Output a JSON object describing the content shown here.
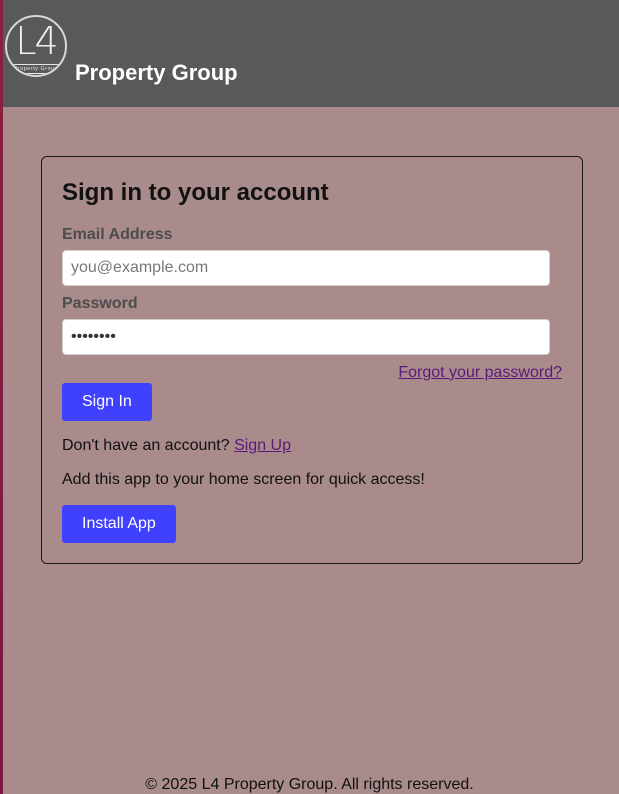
{
  "header": {
    "logo_mark": "L4",
    "logo_sub": "Property Group",
    "brand": "Property Group"
  },
  "login": {
    "title": "Sign in to your account",
    "email_label": "Email Address",
    "email_placeholder": "you@example.com",
    "password_label": "Password",
    "password_value": "••••••••",
    "forgot_link": "Forgot your password?",
    "signin_button": "Sign In",
    "no_account_text": "Don't have an account?",
    "signup_link": "Sign Up",
    "install_prompt": "Add this app to your home screen for quick access!",
    "install_button": "Install App"
  },
  "footer": {
    "copyright": "© 2025 L4 Property Group. All rights reserved."
  },
  "colors": {
    "page_bg": "#a98b8c",
    "header_bg": "#595959",
    "accent": "#4040ff",
    "link": "#5a1a7a"
  }
}
